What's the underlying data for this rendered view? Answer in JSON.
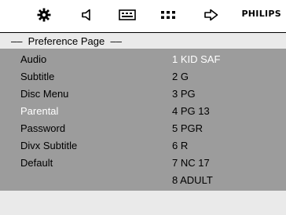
{
  "toolbar": {
    "icons": [
      "gear-icon",
      "speaker-icon",
      "subtitle-icon",
      "grid-icon",
      "enter-icon"
    ],
    "brand": "PHILIPS"
  },
  "page": {
    "title": "––  Preference Page  ––"
  },
  "menu": {
    "items": [
      {
        "label": "Audio"
      },
      {
        "label": "Subtitle"
      },
      {
        "label": "Disc Menu"
      },
      {
        "label": "Parental",
        "selected": true
      },
      {
        "label": "Password"
      },
      {
        "label": "Divx Subtitle"
      },
      {
        "label": "Default"
      }
    ]
  },
  "options": {
    "items": [
      {
        "label": "1 KID SAF",
        "highlighted": true
      },
      {
        "label": "2 G"
      },
      {
        "label": "3 PG"
      },
      {
        "label": "4 PG 13"
      },
      {
        "label": "5 PGR"
      },
      {
        "label": "6 R"
      },
      {
        "label": "7 NC 17"
      },
      {
        "label": "8 ADULT"
      }
    ]
  },
  "colors": {
    "panel": "#9c9c9c",
    "header": "#eaeaea",
    "highlight_text": "#ffffff",
    "text": "#000000"
  }
}
